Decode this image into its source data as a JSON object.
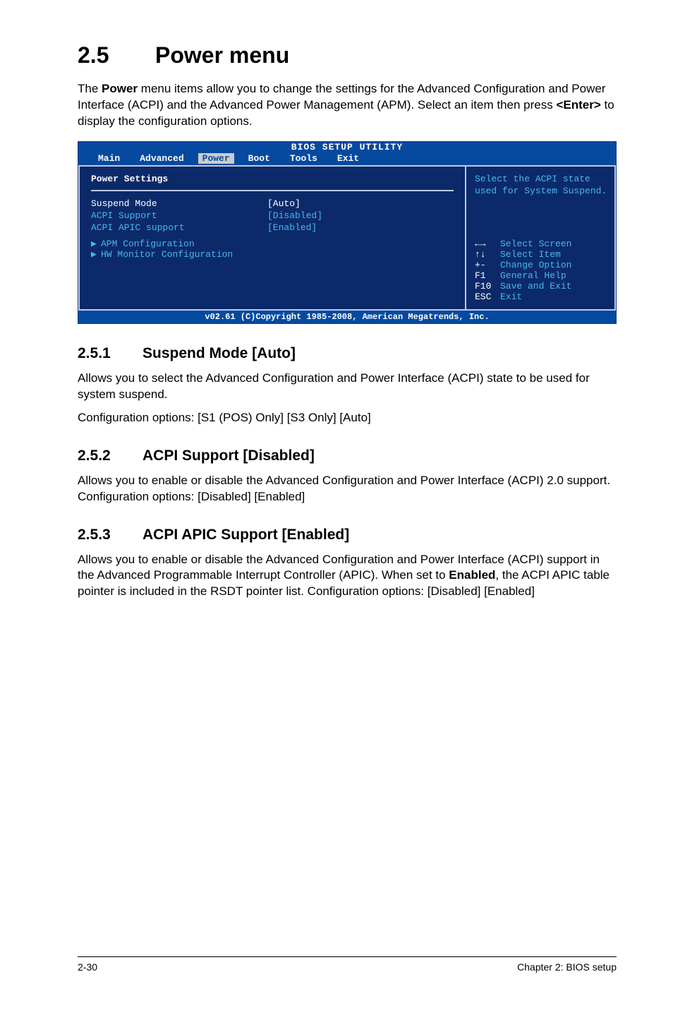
{
  "section": {
    "num": "2.5",
    "title": "Power menu"
  },
  "intro": {
    "l1a": "The ",
    "l1b": "Power",
    "l1c": " menu items allow you to change the settings for the Advanced Configuration and Power Interface (ACPI) and the Advanced Power Management (APM). Select an item then press ",
    "l1d": "<Enter>",
    "l1e": " to display the configuration options."
  },
  "bios": {
    "header": "BIOS SETUP UTILITY",
    "tabs": [
      "Main",
      "Advanced",
      "Power",
      "Boot",
      "Tools",
      "Exit"
    ],
    "settings_title": "Power Settings",
    "rows": [
      {
        "label": "Suspend Mode",
        "value": "[Auto]",
        "selected": true
      },
      {
        "label": "ACPI Support",
        "value": "[Disabled]",
        "selected": false
      },
      {
        "label": "ACPI APIC support",
        "value": "[Enabled]",
        "selected": false
      }
    ],
    "sub_items": [
      "APM Configuration",
      "HW Monitor Configuration"
    ],
    "help": "Select the ACPI state used for System Suspend.",
    "nav": [
      {
        "key": "←→",
        "desc": "Select Screen"
      },
      {
        "key": "↑↓",
        "desc": "Select Item"
      },
      {
        "key": "+-",
        "desc": "Change Option"
      },
      {
        "key": "F1",
        "desc": "General Help"
      },
      {
        "key": "F10",
        "desc": "Save and Exit"
      },
      {
        "key": "ESC",
        "desc": "Exit"
      }
    ],
    "footer": "v02.61 (C)Copyright 1985-2008, American Megatrends, Inc."
  },
  "subs": [
    {
      "num": "2.5.1",
      "title": "Suspend Mode [Auto]",
      "paras": [
        "Allows you to select the Advanced Configuration and Power Interface (ACPI) state to be used for system suspend.",
        "Configuration options: [S1 (POS) Only] [S3 Only] [Auto]"
      ]
    },
    {
      "num": "2.5.2",
      "title": "ACPI Support [Disabled]",
      "paras": [
        "Allows you to enable or disable the Advanced Configuration and Power Interface (ACPI) 2.0 support. Configuration options: [Disabled] [Enabled]"
      ]
    },
    {
      "num": "2.5.3",
      "title": "ACPI APIC Support [Enabled]",
      "paras_special": true
    }
  ],
  "sub3": {
    "t1": "Allows you to enable or disable the Advanced Configuration and Power Interface (ACPI) support in the Advanced Programmable Interrupt Controller (APIC). When set to ",
    "t2": "Enabled",
    "t3": ", the ACPI APIC table pointer is included in the RSDT pointer list. Configuration options: [Disabled] [Enabled]"
  },
  "footer": {
    "left": "2-30",
    "right": "Chapter 2: BIOS setup"
  }
}
